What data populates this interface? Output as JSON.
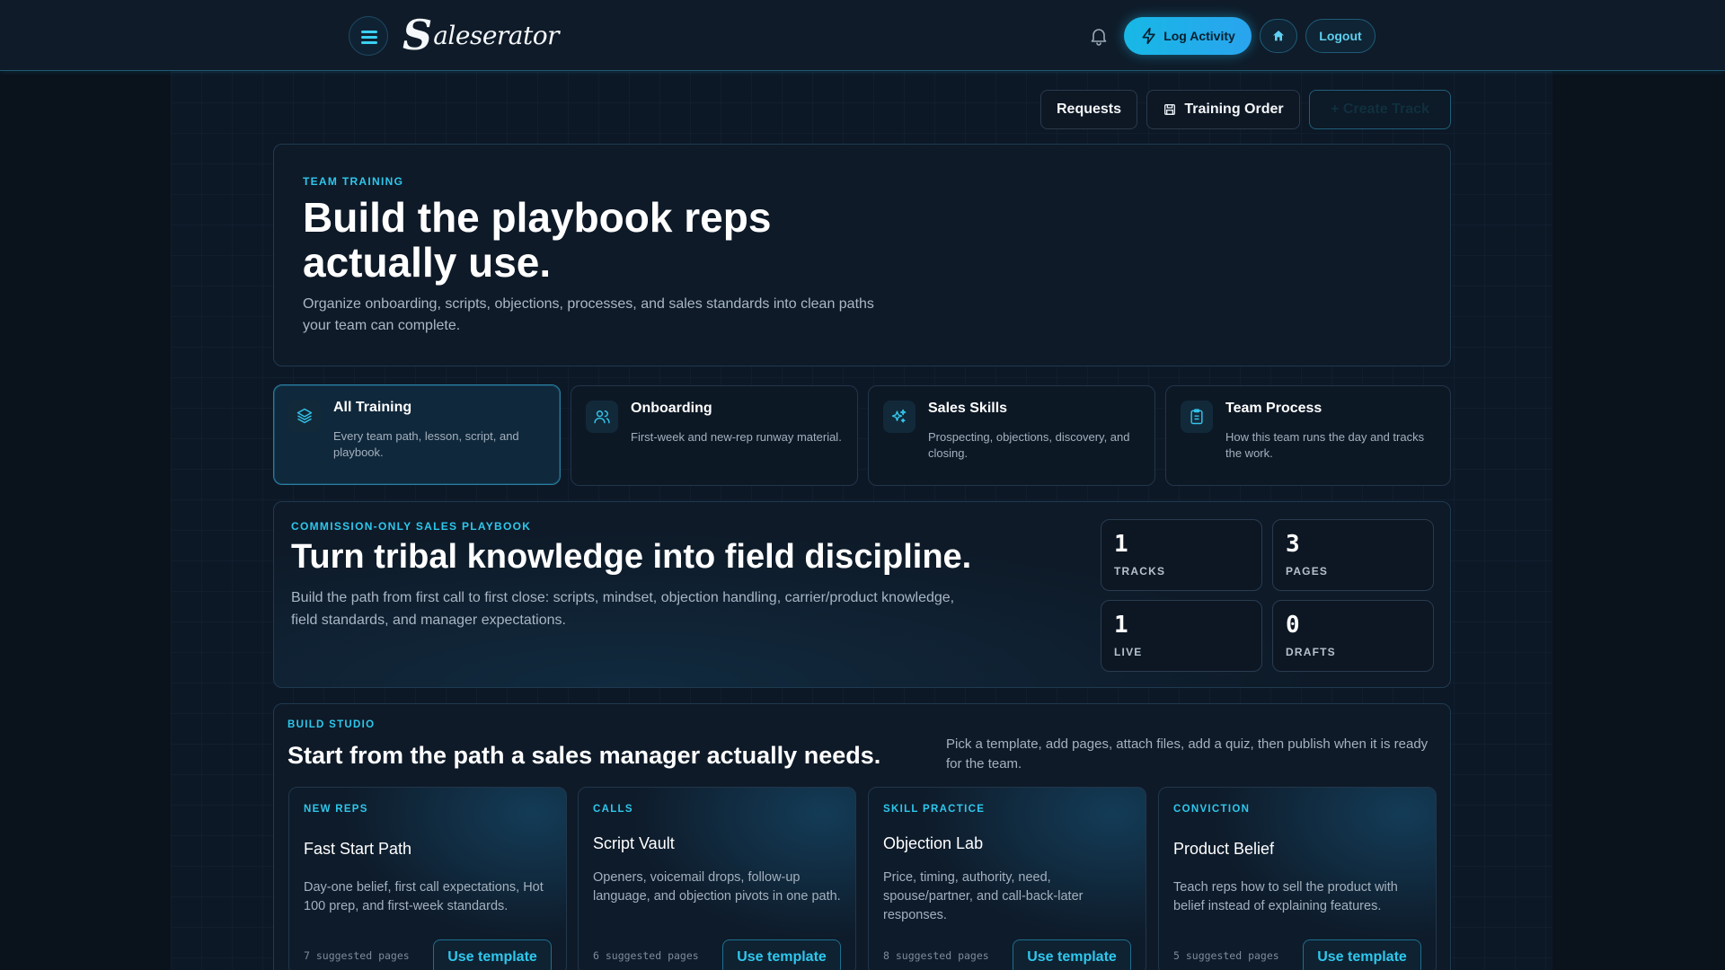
{
  "header": {
    "brand_initial": "S",
    "brand_rest": "aleserator",
    "log_activity_label": "Log Activity",
    "logout_label": "Logout"
  },
  "actions": {
    "requests_label": "Requests",
    "training_order_label": "Training Order",
    "create_track_label": "+ Create Track"
  },
  "hero": {
    "eyebrow": "TEAM TRAINING",
    "title": "Build the playbook reps actually use.",
    "subtitle": "Organize onboarding, scripts, objections, processes, and sales standards into clean paths your team can complete."
  },
  "categories": [
    {
      "title": "All Training",
      "desc": "Every team path, lesson, script, and playbook.",
      "icon": "layers-icon",
      "active": true
    },
    {
      "title": "Onboarding",
      "desc": "First-week and new-rep runway material.",
      "icon": "users-icon",
      "active": false
    },
    {
      "title": "Sales Skills",
      "desc": "Prospecting, objections, discovery, and closing.",
      "icon": "sparkles-icon",
      "active": false
    },
    {
      "title": "Team Process",
      "desc": "How this team runs the day and tracks the work.",
      "icon": "clipboard-icon",
      "active": false
    }
  ],
  "playbook": {
    "eyebrow": "COMMISSION-ONLY SALES PLAYBOOK",
    "title": "Turn tribal knowledge into field discipline.",
    "subtitle": "Build the path from first call to first close: scripts, mindset, objection handling, carrier/product knowledge, field standards, and manager expectations.",
    "stats": [
      {
        "num": "1",
        "label": "TRACKS"
      },
      {
        "num": "3",
        "label": "PAGES"
      },
      {
        "num": "1",
        "label": "LIVE"
      },
      {
        "num": "0",
        "label": "DRAFTS"
      }
    ]
  },
  "studio": {
    "eyebrow": "BUILD STUDIO",
    "title": "Start from the path a sales manager actually needs.",
    "note": "Pick a template, add pages, attach files, add a quiz, then publish when it is ready for the team.",
    "templates": [
      {
        "eyebrow": "NEW REPS",
        "name": "Fast Start Path",
        "desc": "Day-one belief, first call expectations, Hot 100 prep, and first-week standards.",
        "count": "7 suggested pages",
        "button": "Use template"
      },
      {
        "eyebrow": "CALLS",
        "name": "Script Vault",
        "desc": "Openers, voicemail drops, follow-up language, and objection pivots in one path.",
        "count": "6 suggested pages",
        "button": "Use template"
      },
      {
        "eyebrow": "SKILL PRACTICE",
        "name": "Objection Lab",
        "desc": "Price, timing, authority, need, spouse/partner, and call-back-later responses.",
        "count": "8 suggested pages",
        "button": "Use template"
      },
      {
        "eyebrow": "CONVICTION",
        "name": "Product Belief",
        "desc": "Teach reps how to sell the product with belief instead of explaining features.",
        "count": "5 suggested pages",
        "button": "Use template"
      }
    ]
  },
  "colors": {
    "accent": "#2ec7ec",
    "background": "#0d1826",
    "panel": "#0e1a28"
  }
}
